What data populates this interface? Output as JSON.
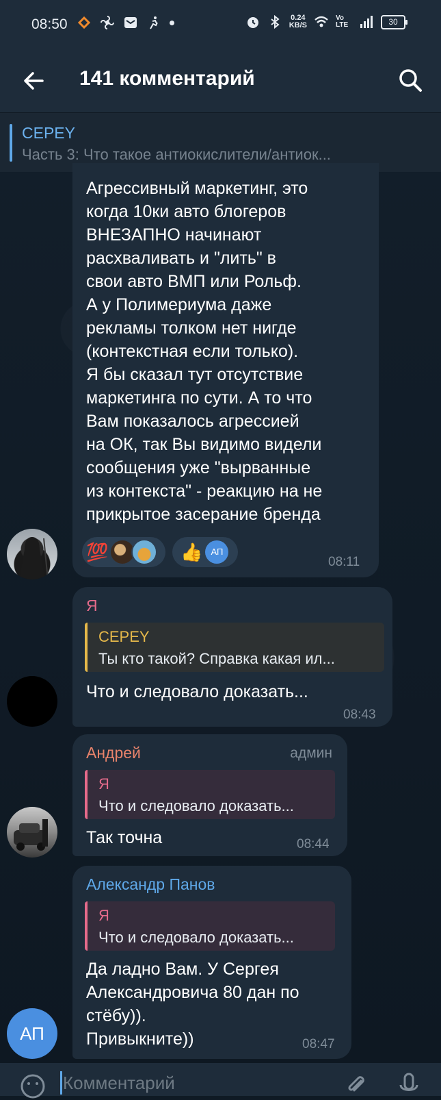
{
  "status": {
    "time": "08:50",
    "net_speed_top": "0.24",
    "net_speed_bottom": "KB/S",
    "network_label": "Vo LTE",
    "battery": "30"
  },
  "header": {
    "title": "141 комментарий"
  },
  "pinned": {
    "name": "СЕРЕY",
    "text": "Часть 3: Что такое антиокислители/антиок..."
  },
  "messages": [
    {
      "text_lines": [
        "Агрессивный маркетинг, это",
        "когда 10ки авто блогеров",
        "ВНЕЗАПНО начинают",
        "расхваливать и \"лить\" в",
        "свои авто ВМП или Рольф.",
        "А у Полимериума даже",
        "рекламы толком нет нигде",
        "(контекстная если только).",
        "Я бы сказал тут отсутствие",
        "маркетинга по сути. А то что",
        "Вам показалось агрессией",
        "на ОК, так Вы видимо видели",
        "сообщения уже \"вырванные",
        "из контекста\" - реакцию на не",
        "прикрытое засерание бренда"
      ],
      "reactions": [
        {
          "emoji": "💯",
          "icon": "hundred-points-icon"
        },
        {
          "emoji": "👍",
          "icon": "thumbs-up-icon",
          "avatar_initials": "АП"
        }
      ],
      "time": "08:11"
    },
    {
      "sender": "Я",
      "reply": {
        "name": "СЕРЕY",
        "text": "Ты кто такой? Справка какая ил..."
      },
      "text": "Что и следовало доказать...",
      "time": "08:43"
    },
    {
      "sender": "Андрей",
      "role": "админ",
      "reply": {
        "name": "Я",
        "text": "Что и следовало доказать..."
      },
      "text": "Так точна",
      "time": "08:44"
    },
    {
      "sender": "Александр Панов",
      "reply": {
        "name": "Я",
        "text": "Что и следовало доказать..."
      },
      "text_lines": [
        "Да ладно Вам. У Сергея",
        "Александровича 80 дан по",
        "стёбу)).",
        "Привыкните))"
      ],
      "avatar_initials": "АП",
      "time": "08:47"
    }
  ],
  "input": {
    "placeholder": "Комментарий"
  },
  "colors": {
    "accent": "#5fa8e8",
    "bubble": "#1e2c3a",
    "me_name": "#e56b8b",
    "reply_gold": "#e5b84a",
    "andrey_name": "#e8836b",
    "panov_name": "#5fa8e8"
  }
}
